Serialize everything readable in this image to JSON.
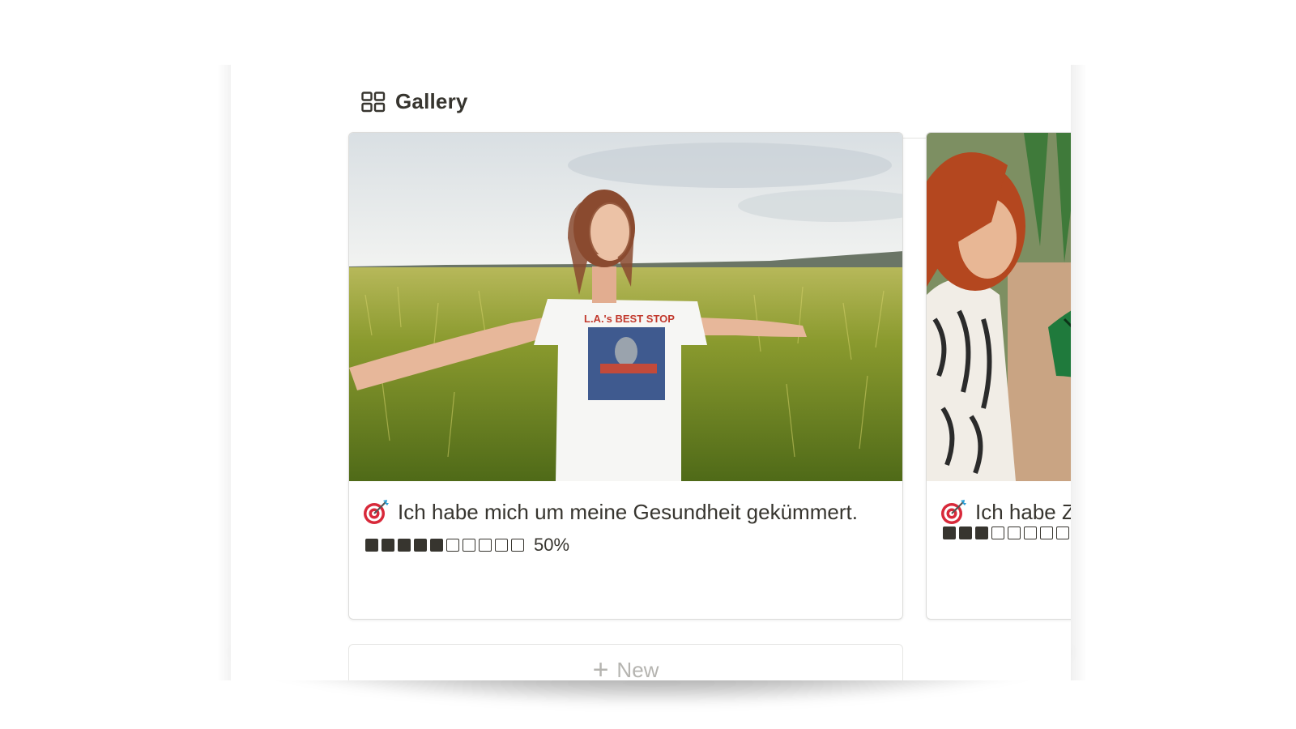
{
  "view": {
    "tab_label": "Gallery",
    "tab_icon": "gallery-grid-icon"
  },
  "cards": [
    {
      "emoji": "direct-hit-target-icon",
      "title": "Ich habe mich um meine Gesundheit gekümmert.",
      "progress_filled": 5,
      "progress_total": 10,
      "progress_label": "50%",
      "cover": "woman-in-grass-field-photo"
    },
    {
      "emoji": "direct-hit-target-icon",
      "title": "Ich habe Z",
      "progress_filled": 3,
      "progress_total": 10,
      "cover": "women-laughing-on-sofa-photo"
    }
  ],
  "new_button": {
    "label": "New",
    "icon": "plus-icon"
  },
  "colors": {
    "text": "#37352f",
    "border": "#dcdcda",
    "muted": "#b5b4b0"
  }
}
